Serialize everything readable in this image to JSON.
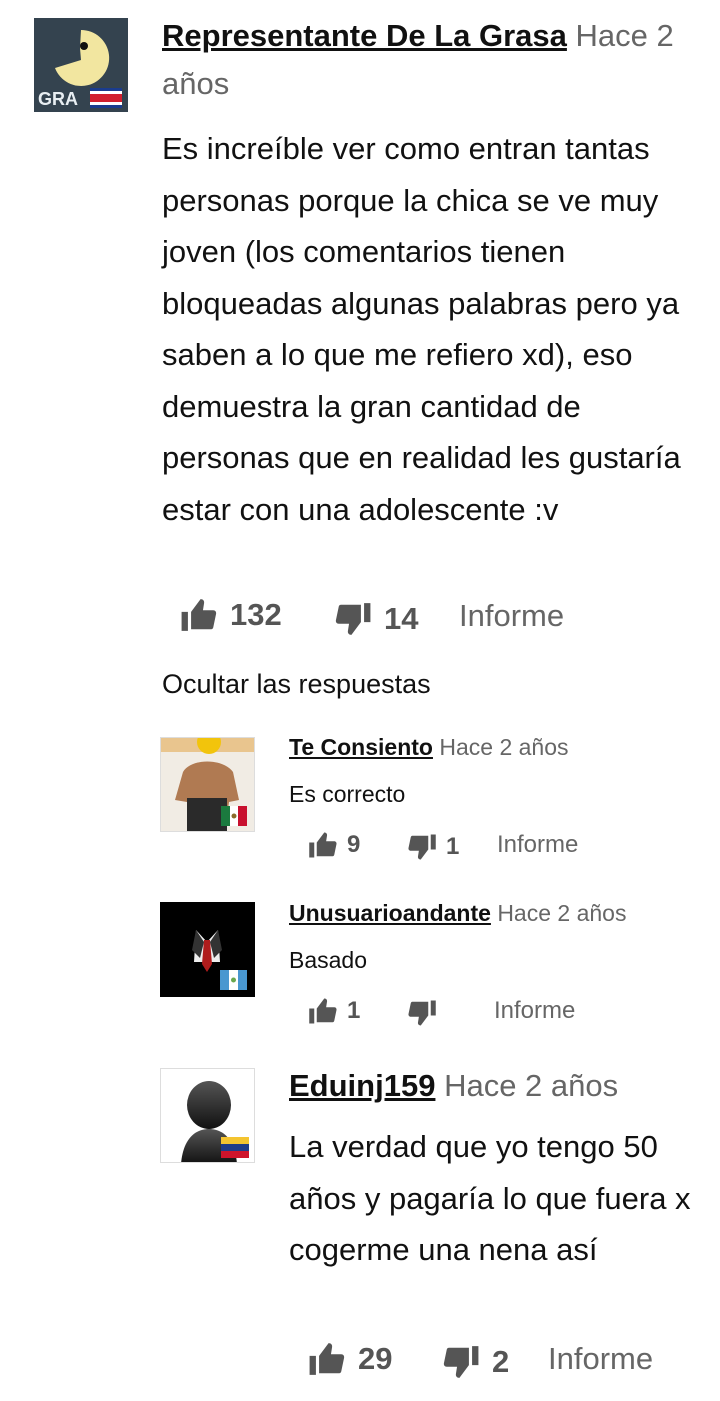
{
  "comment": {
    "author": "Representante De La Grasa",
    "time": "Hace 2 años",
    "text": "Es increíble ver como entran tantas personas porque la chica se ve muy joven (los comentarios tienen bloqueadas algunas palabras pero ya saben a lo que me refiero xd), eso demuestra la gran cantidad de personas que en realidad les gustaría estar con una adolescente :v",
    "likes": "132",
    "dislikes": "14",
    "report_label": "Informe",
    "avatar_label": "GRA",
    "avatar_icon": "pacman-icon",
    "flag": "costa-rica-flag-icon"
  },
  "hide_replies_label": "Ocultar las respuestas",
  "replies": [
    {
      "author": "Te Consiento",
      "time": "Hace 2 años",
      "text": "Es correcto",
      "likes": "9",
      "dislikes": "1",
      "report_label": "Informe",
      "flag": "mexico-flag-icon"
    },
    {
      "author": "Unusuarioandante",
      "time": "Hace 2 años",
      "text": "Basado",
      "likes": "1",
      "dislikes": "",
      "report_label": "Informe",
      "flag": "guatemala-flag-icon"
    },
    {
      "author": "Eduinj159",
      "time": "Hace 2 años",
      "text": "La verdad que yo tengo 50 años y pagaría lo que fuera x cogerme una nena así",
      "likes": "29",
      "dislikes": "2",
      "report_label": "Informe",
      "flag": "venezuela-flag-icon"
    }
  ],
  "colors": {
    "text": "#111111",
    "muted": "#666666",
    "icon": "#555555"
  }
}
